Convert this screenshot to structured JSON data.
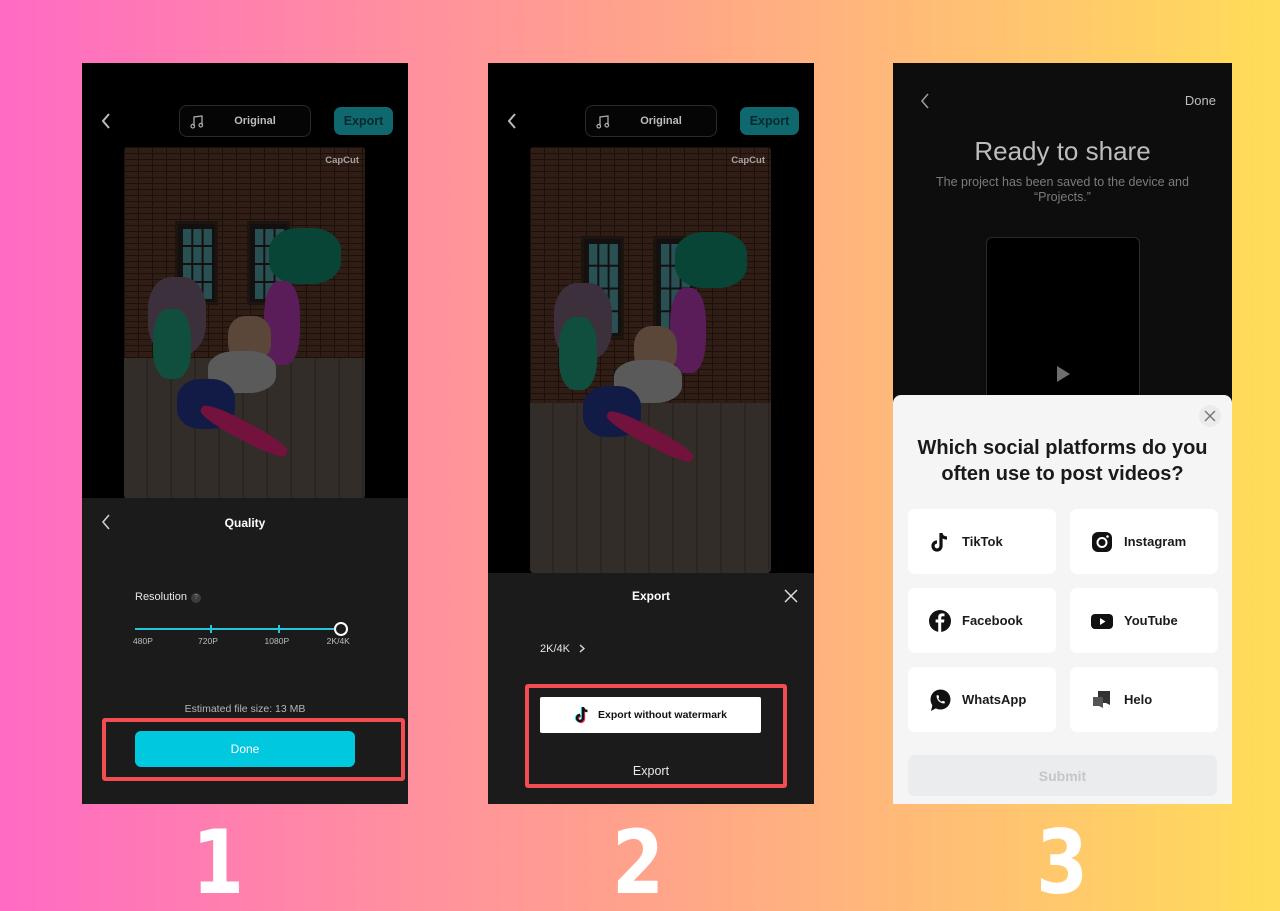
{
  "steps": [
    "1",
    "2",
    "3"
  ],
  "editor": {
    "audio_label": "Original",
    "export_label": "Export",
    "watermark": "CapCut"
  },
  "quality_sheet": {
    "title": "Quality",
    "resolution_label": "Resolution",
    "help_glyph": "?",
    "options": [
      "480P",
      "720P",
      "1080P",
      "2K/4K"
    ],
    "selected": "2K/4K",
    "estimated_size": "Estimated file size: 13 MB",
    "done_label": "Done",
    "accent": "#00c8de"
  },
  "export_sheet": {
    "title": "Export",
    "quality_value": "2K/4K",
    "export_without_watermark_label": "Export without watermark",
    "export_label": "Export",
    "highlight_color": "#f24d50"
  },
  "share": {
    "done_label": "Done",
    "title": "Ready to share",
    "subtitle": "The project has been saved to the device and “Projects.”",
    "survey": {
      "question": "Which social platforms do you often use to post videos?",
      "options": [
        {
          "label": "TikTok",
          "icon": "tiktok-icon"
        },
        {
          "label": "Instagram",
          "icon": "instagram-icon"
        },
        {
          "label": "Facebook",
          "icon": "facebook-icon"
        },
        {
          "label": "YouTube",
          "icon": "youtube-icon"
        },
        {
          "label": "WhatsApp",
          "icon": "whatsapp-icon"
        },
        {
          "label": "Helo",
          "icon": "helo-icon"
        }
      ],
      "submit_label": "Submit"
    }
  }
}
